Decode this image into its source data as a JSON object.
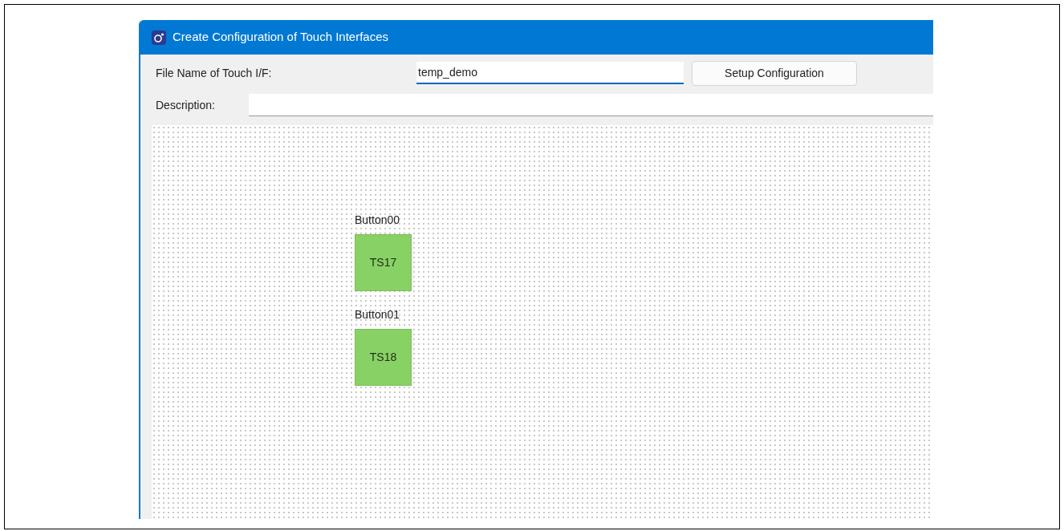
{
  "window": {
    "title": "Create Configuration of Touch Interfaces"
  },
  "file_name": {
    "label": "File Name of Touch I/F:",
    "value": "temp_demo"
  },
  "setup_button": "Setup Configuration",
  "description": {
    "label": "Description:"
  },
  "canvas": {
    "buttons": [
      {
        "name": "Button00",
        "sensor": "TS17"
      },
      {
        "name": "Button01",
        "sensor": "TS18"
      }
    ]
  }
}
